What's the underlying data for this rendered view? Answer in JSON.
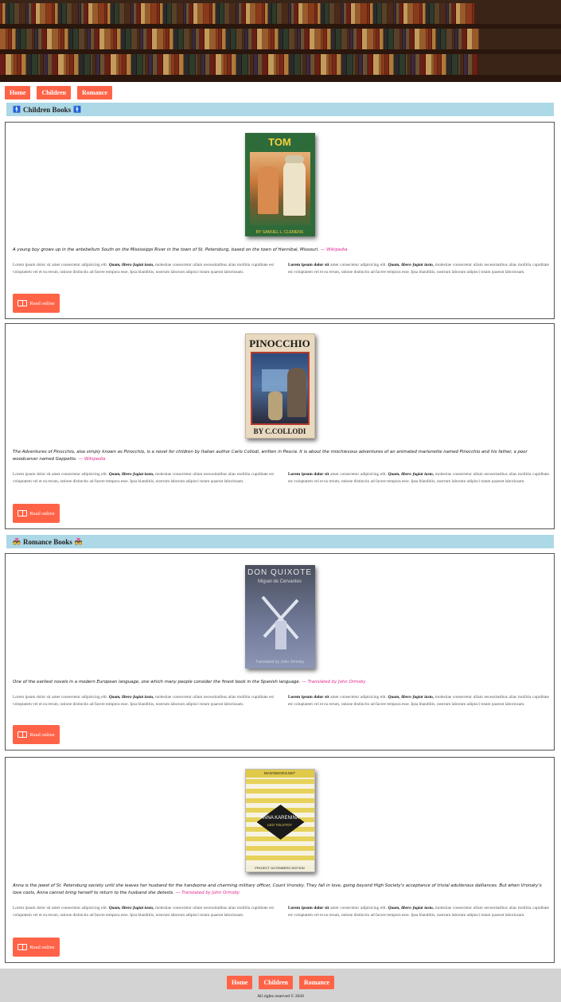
{
  "nav": {
    "home": "Home",
    "children": "Children",
    "romance": "Romance"
  },
  "sections": {
    "children": {
      "title": "Children Books",
      "icon": "🚹"
    },
    "romance": {
      "title": "Romance Books",
      "icon": "💑"
    }
  },
  "books": [
    {
      "cover_title": "TOM SAWYER",
      "cover_author": "BY SAMUEL L. CLEMENS",
      "quote": "A young boy grows up in the antebellum South on the Mississippi River in the town of St. Petersburg, based on the town of Hannibal, Missouri.",
      "source": "--- Wikipedia",
      "read_label": "Read online"
    },
    {
      "cover_title": "PINOCCHIO",
      "cover_author": "BY C.COLLODI",
      "quote": "The Adventures of Pinocchio, also simply known as Pinocchio, is a novel for children by Italian author Carlo Collodi, written in Pescia. It is about the mischievous adventures of an animated marionette named Pinocchio and his father, a poor woodcarver named Geppetto.",
      "source": "--- Wikipedia",
      "read_label": "Read online"
    },
    {
      "cover_title": "DON QUIXOTE",
      "cover_author": "Miguel de Cervantes",
      "cover_note": "Translated by John Ormsby",
      "quote": "One of the earliest novels in a modern European language, one which many people consider the finest book in the Spanish language.",
      "source": "--- Translated by John Ormsby",
      "read_label": "Read online"
    },
    {
      "cover_header": "MANYBOOKS.NET",
      "cover_title": "ANNA KARENINA",
      "cover_author": "LEO TOLSTOY",
      "cover_footer": "PROJECT GUTENBERG EDITION",
      "quote": "Anna is the jewel of St. Petersburg society until she leaves her husband for the handsome and charming military officer, Count Vronsky. They fall in love, going beyond High Society's acceptance of trivial adulterous dalliances. But when Vronsky's love cools, Anna cannot bring herself to return to the husband she detests.",
      "source": "--- Translated by John Ormsby",
      "read_label": "Read online"
    }
  ],
  "lorem": {
    "left_lead": "Lorem ipsum dolor sit amet consectetur adipisicing elit.",
    "left_bold": "Quam, libero fugiat iusto,",
    "left_rest": "molestiae consectetur ullam necessitatibus alias mollitia cupiditate est voluptatem vel et ea rerum, ratione distinctio ad facere tempora esse. Ipsa blanditiis, nostrum laborum adipisci totam quaerat laboriosam.",
    "right_bold_lead": "Lorem ipsum dolor sit",
    "right_lead": "amet consectetur adipisicing elit.",
    "right_bold": "Quam, libero fugiat iusto,",
    "right_rest": "molestiae consectetur ullam necessitatibus alias mollitia cupiditate est voluptatem vel et ea rerum, ratione distinctio ad facere tempora esse. Ipsa blanditiis, nostrum laborum adipisci totam quaerat laboriosam."
  },
  "footer": {
    "home": "Home",
    "children": "Children",
    "romance": "Romance",
    "copyright": "All rights reserved © 2020"
  },
  "colors": {
    "accent": "#ff6347",
    "section_bg": "#add8e6",
    "footer_bg": "#d3d3d3",
    "source_link": "#e0218a"
  }
}
